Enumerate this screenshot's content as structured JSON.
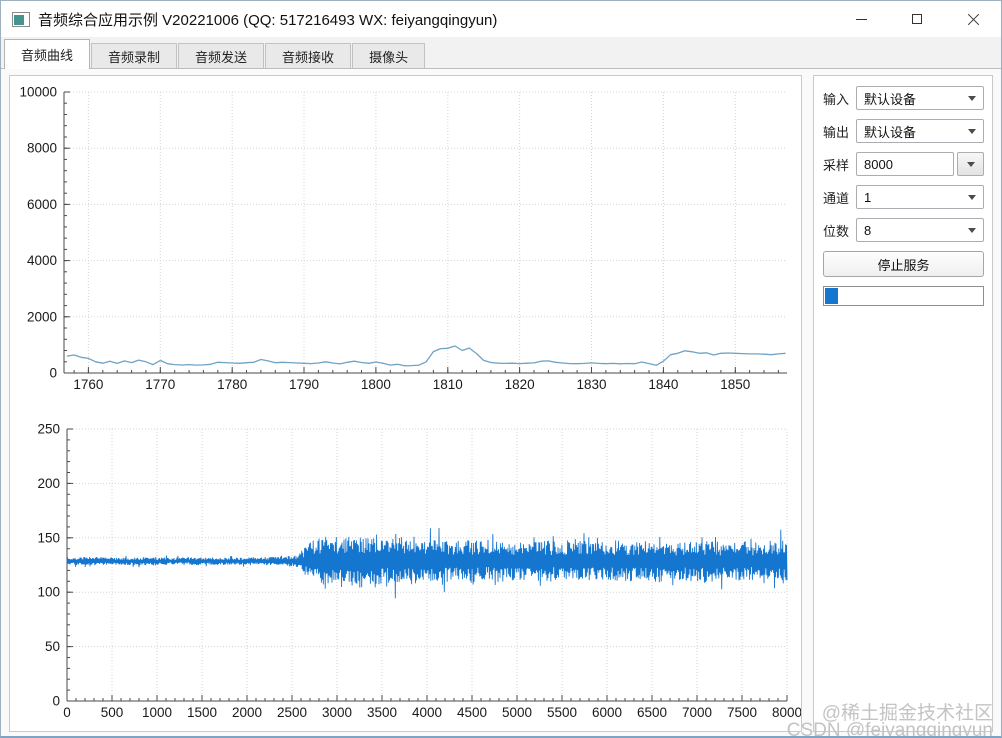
{
  "window": {
    "title": "音频综合应用示例 V20221006 (QQ: 517216493 WX: feiyangqingyun)"
  },
  "tabs": [
    {
      "label": "音频曲线",
      "active": true
    },
    {
      "label": "音频录制",
      "active": false
    },
    {
      "label": "音频发送",
      "active": false
    },
    {
      "label": "音频接收",
      "active": false
    },
    {
      "label": "摄像头",
      "active": false
    }
  ],
  "panel": {
    "rows": [
      {
        "label": "输入",
        "value": "默认设备",
        "editable": false
      },
      {
        "label": "输出",
        "value": "默认设备",
        "editable": false
      },
      {
        "label": "采样",
        "value": "8000",
        "editable": true
      },
      {
        "label": "通道",
        "value": "1",
        "editable": false
      },
      {
        "label": "位数",
        "value": "8",
        "editable": false
      }
    ],
    "stop_button": "停止服务",
    "progress_percent": 8,
    "accent": "#1576d0"
  },
  "watermark": {
    "line1": "@稀土掘金技术社区",
    "line2": "CSDN @feiyangqingyun"
  },
  "chart_data": [
    {
      "type": "line",
      "title": "",
      "xlabel": "",
      "ylabel": "",
      "x_range": [
        1756.6,
        1857.2
      ],
      "y_range": [
        0,
        10000
      ],
      "x_ticks": [
        1760,
        1770,
        1780,
        1790,
        1800,
        1810,
        1820,
        1830,
        1840,
        1850
      ],
      "y_ticks": [
        0,
        2000,
        4000,
        6000,
        8000,
        10000
      ],
      "x_minor_step": 2,
      "y_minor_step": 400,
      "grid": true,
      "grid_color": "#d4d4d4",
      "line_color": "#6fa3c4",
      "legend": null,
      "points": [
        [
          1757,
          600
        ],
        [
          1758,
          640
        ],
        [
          1759,
          560
        ],
        [
          1760,
          520
        ],
        [
          1761,
          400
        ],
        [
          1762,
          350
        ],
        [
          1763,
          420
        ],
        [
          1764,
          340
        ],
        [
          1765,
          430
        ],
        [
          1766,
          370
        ],
        [
          1767,
          460
        ],
        [
          1768,
          400
        ],
        [
          1769,
          300
        ],
        [
          1770,
          450
        ],
        [
          1771,
          330
        ],
        [
          1772,
          300
        ],
        [
          1773,
          285
        ],
        [
          1774,
          300
        ],
        [
          1775,
          280
        ],
        [
          1776,
          290
        ],
        [
          1777,
          310
        ],
        [
          1778,
          380
        ],
        [
          1779,
          370
        ],
        [
          1780,
          355
        ],
        [
          1781,
          345
        ],
        [
          1782,
          365
        ],
        [
          1783,
          380
        ],
        [
          1784,
          480
        ],
        [
          1785,
          430
        ],
        [
          1786,
          365
        ],
        [
          1787,
          380
        ],
        [
          1788,
          370
        ],
        [
          1789,
          355
        ],
        [
          1790,
          345
        ],
        [
          1791,
          335
        ],
        [
          1792,
          355
        ],
        [
          1793,
          400
        ],
        [
          1794,
          355
        ],
        [
          1795,
          325
        ],
        [
          1796,
          380
        ],
        [
          1797,
          420
        ],
        [
          1798,
          375
        ],
        [
          1799,
          345
        ],
        [
          1800,
          390
        ],
        [
          1801,
          345
        ],
        [
          1802,
          280
        ],
        [
          1803,
          310
        ],
        [
          1804,
          255
        ],
        [
          1805,
          265
        ],
        [
          1806,
          280
        ],
        [
          1807,
          400
        ],
        [
          1808,
          760
        ],
        [
          1809,
          870
        ],
        [
          1810,
          880
        ],
        [
          1811,
          960
        ],
        [
          1812,
          800
        ],
        [
          1813,
          890
        ],
        [
          1814,
          690
        ],
        [
          1815,
          450
        ],
        [
          1816,
          375
        ],
        [
          1817,
          350
        ],
        [
          1818,
          340
        ],
        [
          1819,
          350
        ],
        [
          1820,
          335
        ],
        [
          1821,
          350
        ],
        [
          1822,
          360
        ],
        [
          1823,
          420
        ],
        [
          1824,
          430
        ],
        [
          1825,
          380
        ],
        [
          1826,
          355
        ],
        [
          1827,
          335
        ],
        [
          1828,
          330
        ],
        [
          1829,
          340
        ],
        [
          1830,
          360
        ],
        [
          1831,
          340
        ],
        [
          1832,
          330
        ],
        [
          1833,
          340
        ],
        [
          1834,
          328
        ],
        [
          1835,
          338
        ],
        [
          1836,
          330
        ],
        [
          1837,
          390
        ],
        [
          1838,
          335
        ],
        [
          1839,
          275
        ],
        [
          1840,
          420
        ],
        [
          1841,
          650
        ],
        [
          1842,
          700
        ],
        [
          1843,
          790
        ],
        [
          1844,
          755
        ],
        [
          1845,
          700
        ],
        [
          1846,
          720
        ],
        [
          1847,
          640
        ],
        [
          1848,
          700
        ],
        [
          1849,
          710
        ],
        [
          1850,
          700
        ],
        [
          1851,
          690
        ],
        [
          1852,
          680
        ],
        [
          1853,
          680
        ],
        [
          1854,
          668
        ],
        [
          1855,
          650
        ],
        [
          1856,
          680
        ],
        [
          1857,
          700
        ]
      ]
    },
    {
      "type": "line",
      "title": "",
      "xlabel": "",
      "ylabel": "",
      "x_range": [
        0,
        8000
      ],
      "y_range": [
        0,
        250
      ],
      "x_ticks": [
        0,
        500,
        1000,
        1500,
        2000,
        2500,
        3000,
        3500,
        4000,
        4500,
        5000,
        5500,
        6000,
        6500,
        7000,
        7500,
        8000
      ],
      "y_ticks": [
        0,
        50,
        100,
        150,
        200,
        250
      ],
      "x_minor_step": 100,
      "y_minor_step": 10,
      "grid": true,
      "grid_color": "#d4d4d4",
      "line_color": "#1576d0",
      "legend": null,
      "waveform": {
        "center": 128.5,
        "envelope": [
          [
            0,
            3.5
          ],
          [
            300,
            4
          ],
          [
            600,
            3.3
          ],
          [
            900,
            4
          ],
          [
            1200,
            3.3
          ],
          [
            1500,
            3.8
          ],
          [
            1800,
            3.3
          ],
          [
            2100,
            3.8
          ],
          [
            2400,
            4.3
          ],
          [
            2550,
            5.5
          ],
          [
            2650,
            13
          ],
          [
            2750,
            21
          ],
          [
            2850,
            24
          ],
          [
            2950,
            20
          ],
          [
            3050,
            26
          ],
          [
            3150,
            22
          ],
          [
            3250,
            27
          ],
          [
            3350,
            22
          ],
          [
            3450,
            25
          ],
          [
            3550,
            20
          ],
          [
            3650,
            26
          ],
          [
            3750,
            22
          ],
          [
            3850,
            23
          ],
          [
            3950,
            19
          ],
          [
            4100,
            21
          ],
          [
            4300,
            18
          ],
          [
            4500,
            20
          ],
          [
            4700,
            17
          ],
          [
            4900,
            20
          ],
          [
            5100,
            18
          ],
          [
            5300,
            20
          ],
          [
            5500,
            17
          ],
          [
            5700,
            19
          ],
          [
            5900,
            17
          ],
          [
            6100,
            20
          ],
          [
            6300,
            18
          ],
          [
            6500,
            20
          ],
          [
            6700,
            17
          ],
          [
            6900,
            19
          ],
          [
            7100,
            20
          ],
          [
            7300,
            17
          ],
          [
            7500,
            19
          ],
          [
            7700,
            17
          ],
          [
            7900,
            20
          ],
          [
            8000,
            18
          ]
        ]
      }
    }
  ]
}
